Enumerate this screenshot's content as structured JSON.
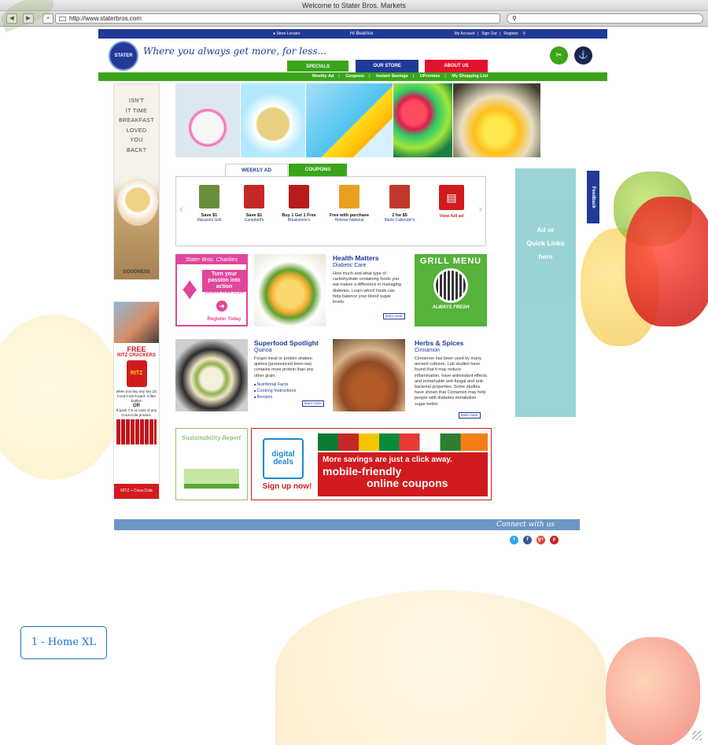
{
  "browser": {
    "title": "Welcome to Stater Bros. Markets",
    "url": "http://www.staterbros.com",
    "back": "◀",
    "forward": "▶",
    "newtab": "+"
  },
  "topbar": {
    "store_locator": "Store Locator",
    "greeting": "Hi Beatrice",
    "my_account": "My Account",
    "sign_out": "Sign Out",
    "register": "Register"
  },
  "header": {
    "logo_text": "STATER BROS",
    "tagline": "Where you always get more, for less...",
    "tabs": [
      "SPECIALS",
      "OUR STORE",
      "ABOUT US"
    ]
  },
  "subnav": [
    "Weekly Ad",
    "Coupons",
    "Instant Savings",
    "UPromise",
    "My Shopping List"
  ],
  "left_ad_1": {
    "lines": [
      "ISN'T",
      "IT TIME",
      "BREAKFAST",
      "LOVED",
      "YOU",
      "BACK?"
    ],
    "brand": "GOODNESS"
  },
  "left_ad_2": {
    "free": "FREE",
    "ritz": "RITZ CRACKERS",
    "box": "RITZ",
    "offer": "when you buy any two (2) Coca-Cola 6-pack .5 liter bottles",
    "or": "OR",
    "offer2": "8-pack 7.5 oz cans of any Coca-Cola product.",
    "bottom": "RITZ + Coca-Cola"
  },
  "sub_tabs": [
    "WEEKLY AD",
    "COUPONS"
  ],
  "carousel": [
    {
      "deal": "Save $1",
      "product": "Macaroni Grill",
      "color": "#6a8e3c"
    },
    {
      "deal": "Save $1",
      "product": "Campbell's",
      "color": "#c62828"
    },
    {
      "deal": "Buy 1 Get 1 Free",
      "product": "Breakstone's",
      "color": "#b71c1c"
    },
    {
      "deal": "Free with purchase",
      "product": "Hebrew National",
      "color": "#e8a020"
    },
    {
      "deal": "2 for $5",
      "product": "Marie Callender's",
      "color": "#c0392b"
    }
  ],
  "view_full_ad": "View full ad",
  "charities": {
    "head": "Stater Bros. Charities",
    "passion": "Turn your passion into action",
    "walk": "Believe Walk 2014",
    "register": "Register Today"
  },
  "health": {
    "title": "Health Matters",
    "subtitle": "Diabetic Care",
    "body": "How much and what type of carbohydrate containing foods you eat makes a difference in managing diabetes. Learn which foods can help balance your blood sugar levels.",
    "learn": "learn more"
  },
  "grill": {
    "title": "GRILL MENU",
    "tag": "ALWAYS FRESH"
  },
  "superfood": {
    "title": "Superfood Spotlight",
    "subtitle": "Quinoa",
    "body": "Forget meat or protein shakes; quinoa (pronounced keen-wa) contains more protein than any other grain.",
    "links": [
      "Nutritional Facts",
      "Cooking Instructions",
      "Recipes"
    ],
    "learn": "learn more"
  },
  "herbs": {
    "title": "Herbs & Spices",
    "subtitle": "Cinnamon",
    "body": "Cinnamon has been used by many ancient cultures. Lab studies have found that it may reduce inflammation, have antioxidant effects and remarkable anti-fungal and anti-bacterial properties. Some studies have shown that Cinnamon may help people with diabetes metabolise sugar better.",
    "learn": "learn more"
  },
  "right_ad": {
    "line1": "Ad or",
    "line2": "Quick Links",
    "line3": "here"
  },
  "feedback": "Feedback",
  "sustainability": "Sustainability Report",
  "digital": {
    "badge_top": "digital",
    "badge_bottom": "deals",
    "signup": "Sign up now!",
    "line1": "More savings are just a click away.",
    "line2": "mobile-friendly",
    "line3": "online coupons"
  },
  "footer": {
    "connect": "Connect with us",
    "social": [
      "t",
      "f",
      "g+",
      "p"
    ]
  },
  "page_label": "1 - Home XL"
}
